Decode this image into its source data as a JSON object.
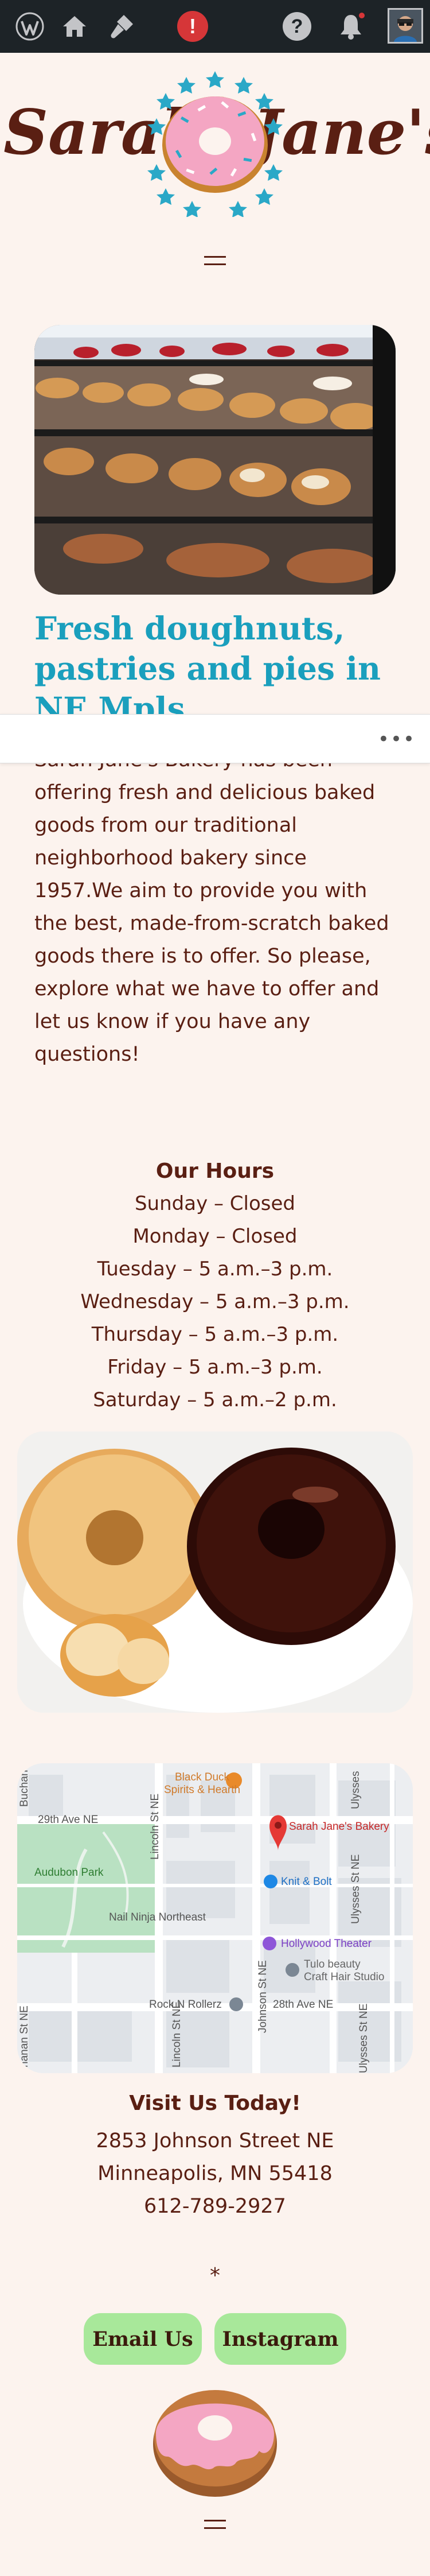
{
  "admin_bar": {
    "icons": [
      "wordpress-logo-icon",
      "home-icon",
      "customize-brush-icon",
      "update-alert-icon",
      "help-icon",
      "notifications-bell-icon",
      "user-avatar"
    ],
    "update_mark": "!",
    "help_mark": "?"
  },
  "logo": {
    "left_word": "Sarah",
    "right_word": "Jane's"
  },
  "hero": {
    "headline": "Fresh doughnuts, pastries and pies in NE Mpls",
    "intro": "Sarah Jane's Bakery has been offering fresh and delicious baked goods from our traditional neighborhood bakery since 1957.We aim to provide you with the best, made-from-scratch baked goods there is to offer. So please, explore what we have to offer and let us know if you have any questions!"
  },
  "popup": {
    "more_label": "•••"
  },
  "hours": {
    "title": "Our Hours",
    "lines": [
      "Sunday – Closed",
      "Monday – Closed",
      "Tuesday – 5 a.m.–3 p.m.",
      "Wednesday – 5 a.m.–3 p.m.",
      "Thursday – 5 a.m.–3 p.m.",
      "Friday – 5 a.m.–3 p.m.",
      "Saturday – 5 a.m.–2 p.m."
    ]
  },
  "map": {
    "labels": {
      "black_duck": "Black Duck\nSpirits & Hearth",
      "bakery": "Sarah Jane's Bakery",
      "knit_bolt": "Knit & Bolt",
      "audubon": "Audubon Park",
      "nail_ninja": "Nail Ninja Northeast",
      "hollywood": "Hollywood Theater",
      "tulo": "Tulo beauty\nCraft Hair Studio",
      "rock_n": "Rock N Rollerz",
      "ave_29": "29th Ave NE",
      "ave_28": "28th Ave NE",
      "lincoln_top": "Lincoln St NE",
      "lincoln_bot": "Lincoln St NE",
      "johnson": "Johnson St NE",
      "ulysses_top": "Ulysses",
      "ulysses_mid": "Ulysses St NE",
      "ulysses_bot": "Ulysses St NE",
      "buchanan_top": "Buchan",
      "buchanan_bot": "hanan St NE"
    }
  },
  "visit": {
    "title": "Visit Us Today!",
    "street": "2853 Johnson Street NE",
    "city": "Minneapolis, MN 55418",
    "phone": "612-789-2927"
  },
  "footer": {
    "asterisk": "*",
    "email_label": "Email Us",
    "instagram_label": "Instagram"
  },
  "colors": {
    "background": "#fcf3ee",
    "brown": "#5a1f13",
    "teal": "#1a9fbd",
    "button_green": "#a8e89a",
    "frosting_pink": "#f4a6c3"
  }
}
